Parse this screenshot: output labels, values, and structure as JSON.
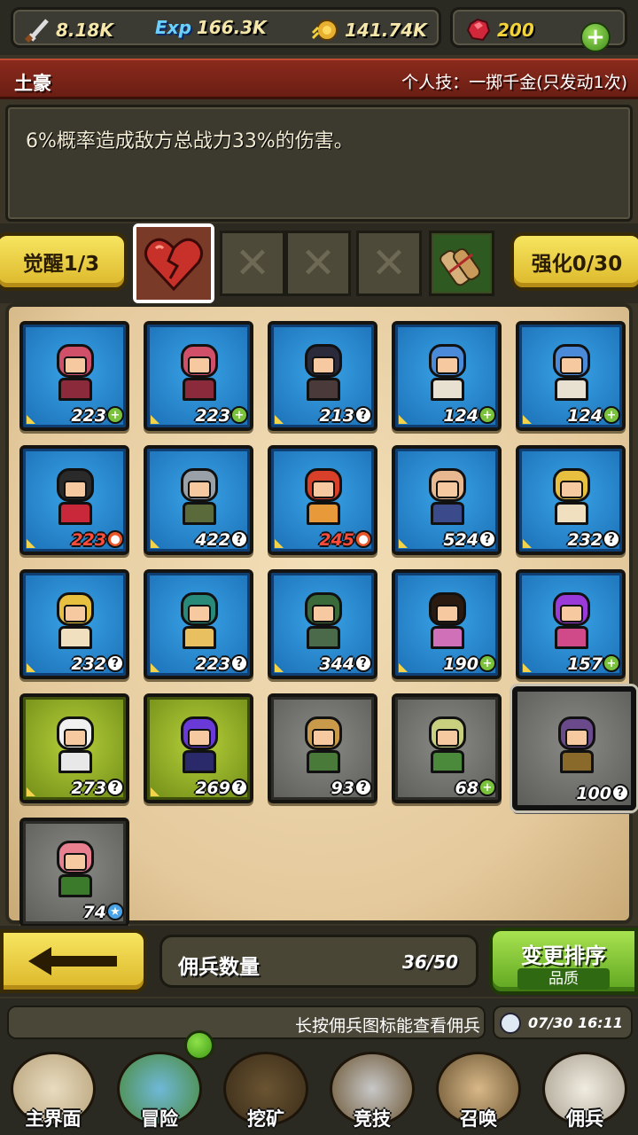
{
  "resources": {
    "attack": "8.18K",
    "exp": "166.3K",
    "exp_icon_text": "Exp",
    "gold": "141.74K",
    "gems": "200"
  },
  "skill": {
    "name": "土豪",
    "label": "个人技：一掷千金(只发动1次)",
    "description": "6%概率造成敌方总战力33%的伤害。"
  },
  "awaken": {
    "label": "觉醒1/3",
    "enhance_label": "强化0/30"
  },
  "mercenaries": [
    {
      "level": "223",
      "badge": "+",
      "rarity": "blue"
    },
    {
      "level": "223",
      "badge": "+",
      "rarity": "blue"
    },
    {
      "level": "213",
      "badge": "?",
      "rarity": "blue"
    },
    {
      "level": "124",
      "badge": "+",
      "rarity": "blue"
    },
    {
      "level": "124",
      "badge": "+",
      "rarity": "blue"
    },
    {
      "level": "223",
      "badge": "fire",
      "rarity": "blue",
      "red": true
    },
    {
      "level": "422",
      "badge": "?",
      "rarity": "blue"
    },
    {
      "level": "245",
      "badge": "fire",
      "rarity": "blue",
      "red": true
    },
    {
      "level": "524",
      "badge": "?",
      "rarity": "blue"
    },
    {
      "level": "232",
      "badge": "?",
      "rarity": "blue"
    },
    {
      "level": "232",
      "badge": "?",
      "rarity": "blue"
    },
    {
      "level": "223",
      "badge": "?",
      "rarity": "blue"
    },
    {
      "level": "344",
      "badge": "?",
      "rarity": "blue"
    },
    {
      "level": "190",
      "badge": "+",
      "rarity": "blue"
    },
    {
      "level": "157",
      "badge": "+",
      "rarity": "blue"
    },
    {
      "level": "273",
      "badge": "?",
      "rarity": "green"
    },
    {
      "level": "269",
      "badge": "?",
      "rarity": "green"
    },
    {
      "level": "93",
      "badge": "?",
      "rarity": "gray"
    },
    {
      "level": "68",
      "badge": "+",
      "rarity": "gray"
    },
    {
      "level": "100",
      "badge": "?",
      "rarity": "gray",
      "selected": true
    },
    {
      "level": "74",
      "badge": "star",
      "rarity": "gray"
    }
  ],
  "controls": {
    "count_label": "佣兵数量",
    "count_value": "36/50",
    "sort_title": "变更排序",
    "sort_sub": "品质"
  },
  "ticker": {
    "text": "长按佣兵图标能查看佣兵",
    "time": "07/30 16:11"
  },
  "nav": {
    "items": [
      "主界面",
      "冒险",
      "挖矿",
      "竞技",
      "召唤",
      "佣兵"
    ]
  }
}
